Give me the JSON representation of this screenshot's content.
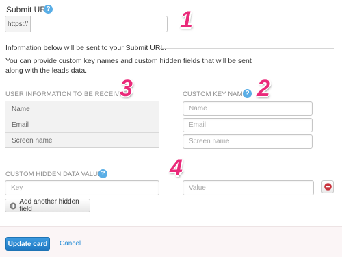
{
  "submit_url": {
    "label": "Submit URL",
    "help_glyph": "?",
    "prefix": "https://",
    "value": ""
  },
  "info": {
    "heading": "Information below will be sent to your Submit URL.",
    "description": "You can provide custom key names and custom hidden fields that will be sent along with the leads data."
  },
  "user_info": {
    "label": "USER INFORMATION TO BE RECEIVED",
    "rows": [
      "Name",
      "Email",
      "Screen name"
    ]
  },
  "custom_keys": {
    "label": "CUSTOM KEY NAME",
    "help_glyph": "?",
    "placeholders": [
      "Name",
      "Email",
      "Screen name"
    ]
  },
  "hidden_data": {
    "label": "CUSTOM HIDDEN DATA VALUES",
    "help_glyph": "?",
    "key_placeholder": "Key",
    "value_placeholder": "Value",
    "add_label": "Add another hidden field"
  },
  "annotations": [
    "1",
    "2",
    "3",
    "4"
  ],
  "footer": {
    "update_label": "Update card",
    "cancel_label": "Cancel"
  },
  "colors": {
    "accent": "#2a8ed6",
    "annotation": "#ea2a7a",
    "help": "#5aaee6",
    "remove": "#c8323c"
  },
  "icons": {
    "help": "question-circle-icon",
    "add": "plus-circle-icon",
    "remove": "minus-circle-icon"
  }
}
